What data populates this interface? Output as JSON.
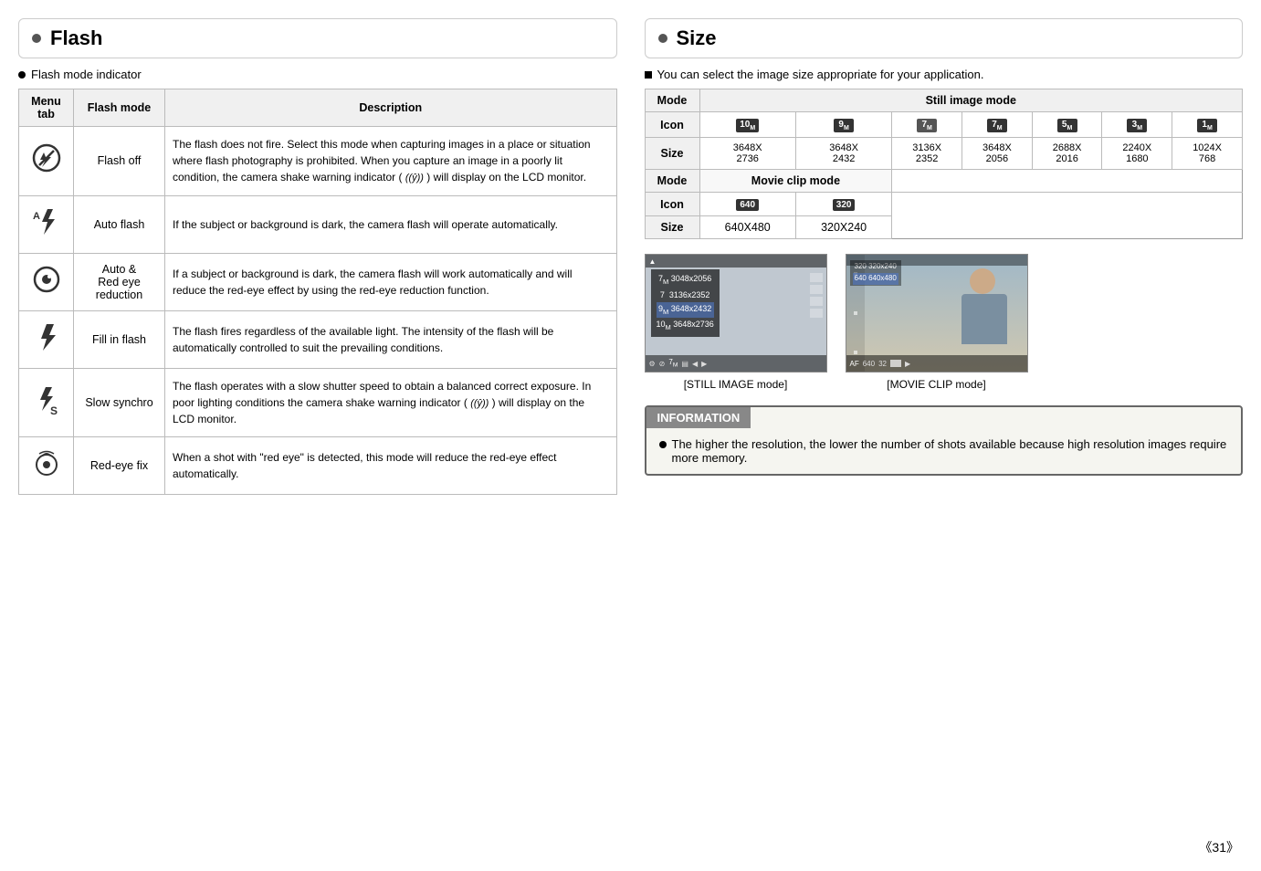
{
  "flash_section": {
    "title": "Flash",
    "bullet": "Flash mode indicator",
    "table_headers": [
      "Menu tab",
      "Flash mode",
      "Description"
    ],
    "rows": [
      {
        "icon": "⊘",
        "mode": "Flash off",
        "description": "The flash does not fire. Select this mode when capturing images in a place or situation where flash photography is prohibited. When you capture an image in a poorly lit condition, the camera shake warning indicator (  ) will display on the LCD monitor."
      },
      {
        "icon": "⚡",
        "mode": "Auto flash",
        "description": "If the subject or background is dark, the camera flash will operate automatically."
      },
      {
        "icon": "◎",
        "mode": "Auto &\nRed eye\nreduction",
        "description": "If a subject or background is dark, the camera flash will work automatically and will reduce the red-eye effect by using the red-eye reduction function."
      },
      {
        "icon": "↯",
        "mode": "Fill in flash",
        "description": "The flash fires regardless of the available light. The intensity of the flash will be automatically controlled to suit the prevailing conditions."
      },
      {
        "icon": "↯s",
        "mode": "Slow synchro",
        "description": "The flash operates with a slow shutter speed to obtain a balanced correct exposure. In poor lighting conditions the camera shake warning indicator (  ) will display on the LCD monitor."
      },
      {
        "icon": "⊕",
        "mode": "Red-eye fix",
        "description": "When a shot with \"red eye\" is detected, this mode will reduce the red-eye effect automatically."
      }
    ]
  },
  "size_section": {
    "title": "Size",
    "bullet": "You can select the image size appropriate for your application.",
    "still_mode_label": "Still image mode",
    "movie_mode_label": "Movie clip mode",
    "still_headers": [
      "Mode",
      "Still image mode"
    ],
    "still_row_icon_label": "Icon",
    "still_row_size_label": "Size",
    "still_icons": [
      "10•",
      "9•",
      "7•",
      "7M",
      "5•",
      "3•",
      "1•"
    ],
    "still_sizes": [
      [
        "3648X",
        "2736"
      ],
      [
        "3648X",
        "2432"
      ],
      [
        "3136X",
        "2352"
      ],
      [
        "3648X",
        "2056"
      ],
      [
        "2688X",
        "2016"
      ],
      [
        "2240X",
        "1680"
      ],
      [
        "1024X",
        "768"
      ]
    ],
    "movie_row_icon_label": "Icon",
    "movie_row_size_label": "Size",
    "movie_icons": [
      "640",
      "320"
    ],
    "movie_sizes": [
      "640X480",
      "320X240"
    ],
    "still_caption": "[STILL IMAGE mode]",
    "movie_caption": "[MOVIE CLIP mode]",
    "still_menu_items": [
      "7• 3048x2056",
      "7 3136x2352",
      "9• 3648x2432",
      "10• 3648x2736"
    ],
    "movie_size_items": [
      "320 320x240",
      "640 640x480"
    ],
    "info_header": "INFORMATION",
    "info_text": "The higher the resolution, the lower the number of shots available because high resolution images require more memory."
  },
  "page_number": "《31》"
}
